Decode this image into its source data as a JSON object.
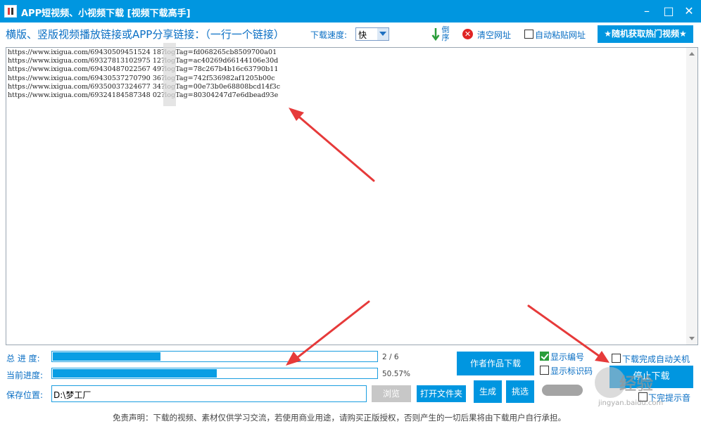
{
  "window": {
    "title": "APP短视频、小视频下载 [视频下载高手]",
    "controls": {
      "minimize": "–",
      "maximize": "□",
      "close": "✕"
    }
  },
  "toolbar": {
    "prompt": "横版、竖版视频播放链接或APP分享链接：（一行一个链接）",
    "speed_label": "下载速度:",
    "speed_value": "快",
    "reverse_label": "倒序",
    "clear_label": "清空网址",
    "auto_paste_label": "自动粘贴网址",
    "auto_paste_checked": false,
    "hot_video_button": "★随机获取热门视频★"
  },
  "urls": [
    "https://www.ixigua.com/69430509451524 18?logTag=fd068265cb8509700a01",
    "https://www.ixigua.com/69327813102975 12?logTag=ac40269d66144106e30d",
    "https://www.ixigua.com/69430487022567 49?logTag=78c267b4b16c63790b11",
    "https://www.ixigua.com/69430537270790 36?logTag=742f536982af1205b00c",
    "https://www.ixigua.com/69350037324677 34?logTag=00e73b0e68808bcd14f3c",
    "https://www.ixigua.com/69324184587348 02?logTag=80304247d7e6dbead93e"
  ],
  "progress": {
    "total_label": "总 进 度:",
    "total_text": "2 / 6",
    "total_fraction": 0.333,
    "current_label": "当前进度:",
    "current_text": "50.57%",
    "current_fraction": 0.5057
  },
  "save": {
    "label": "保存位置:",
    "path": "D:\\梦工厂",
    "browse_button": "浏览",
    "open_folder_button": "打开文件夹",
    "generate_button": "生成",
    "filter_button": "挑选"
  },
  "actions": {
    "author_download_button": "作者作品下载",
    "show_number_label": "显示编号",
    "show_number_checked": true,
    "show_title_label": "显示标识码",
    "show_title_checked": false,
    "shutdown_label": "下载完成自动关机",
    "shutdown_checked": false,
    "stop_button": "停止下载",
    "sound_label": "下完提示音",
    "sound_checked": false
  },
  "disclaimer": "免责声明：下载的视频、素材仅供学习交流，若使用商业用途，请购买正版授权，否则产生的一切后果将由下载用户自行承担。",
  "watermark": {
    "text": "经验",
    "sub": "jingyan.baidu.com"
  },
  "colors": {
    "accent": "#0096e0",
    "progress": "#0a9ee4",
    "arrow": "#e63a3a",
    "label": "#0a6fc4"
  }
}
